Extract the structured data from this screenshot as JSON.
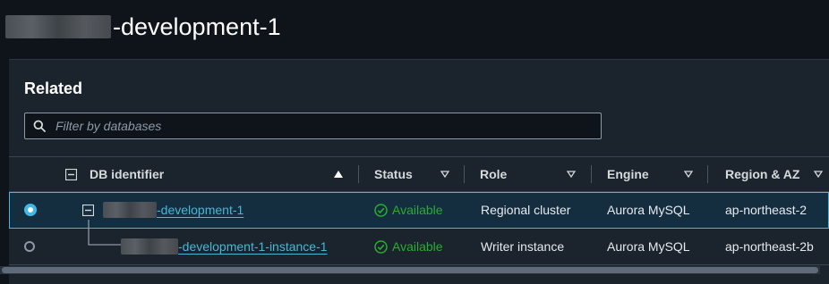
{
  "page": {
    "title_suffix": "-development-1"
  },
  "related": {
    "header": "Related",
    "filter": {
      "placeholder": "Filter by databases",
      "value": ""
    },
    "columns": {
      "db_identifier": "DB identifier",
      "status": "Status",
      "role": "Role",
      "engine": "Engine",
      "region_az": "Region & AZ"
    },
    "rows": [
      {
        "id_suffix": "-development-1",
        "status": "Available",
        "role": "Regional cluster",
        "engine": "Aurora MySQL",
        "region": "ap-northeast-2",
        "selected": true
      },
      {
        "id_suffix": "-development-1-instance-1",
        "status": "Available",
        "role": "Writer instance",
        "engine": "Aurora MySQL",
        "region": "ap-northeast-2b",
        "selected": false
      }
    ]
  },
  "colors": {
    "accent": "#3fb8e8",
    "link": "#44b9d6",
    "success": "#29ad32",
    "background": "#0f141a",
    "panel": "#1b232d"
  }
}
